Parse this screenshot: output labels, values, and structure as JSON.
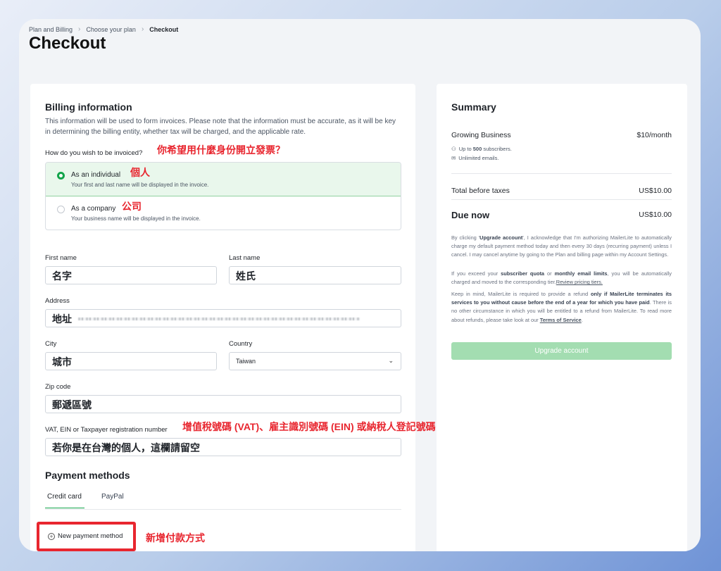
{
  "breadcrumb": {
    "items": [
      "Plan and Billing",
      "Choose your plan",
      "Checkout"
    ]
  },
  "page": {
    "title": "Checkout"
  },
  "billing": {
    "title": "Billing information",
    "description": "This information will be used to form invoices. Please note that the information must be accurate, as it will be key in determining the billing entity, whether tax will be charged, and the applicable rate.",
    "invoice_question": "How do you wish to be invoiced?",
    "invoice_question_annotation": "你希望用什麼身份開立發票？",
    "options": [
      {
        "title": "As an individual",
        "annotation": "個人",
        "subtitle": "Your first and last name will be displayed in the invoice.",
        "selected": true
      },
      {
        "title": "As a company",
        "annotation": "公司",
        "subtitle": "Your business name will be displayed in the invoice.",
        "selected": false
      }
    ]
  },
  "fields": {
    "first_name": {
      "label": "First name",
      "value": "名字"
    },
    "last_name": {
      "label": "Last name",
      "value": "姓氏"
    },
    "address": {
      "label": "Address",
      "value": "地址"
    },
    "city": {
      "label": "City",
      "value": "城市"
    },
    "country": {
      "label": "Country",
      "value": "Taiwan"
    },
    "zip": {
      "label": "Zip code",
      "value": "郵遞區號"
    },
    "vat": {
      "label": "VAT, EIN or Taxpayer registration number",
      "annotation": "增值稅號碼 (VAT)、雇主識別號碼 (EIN) 或納稅人登記號碼",
      "value": "若你是在台灣的個人，這欄請留空"
    }
  },
  "payment": {
    "title": "Payment methods",
    "tabs": [
      "Credit card",
      "PayPal"
    ],
    "new_method": "New payment method",
    "new_method_annotation": "新增付款方式"
  },
  "summary": {
    "title": "Summary",
    "plan_name": "Growing Business",
    "plan_price": "$10/month",
    "subscribers_prefix": "Up to ",
    "subscribers_count": "500",
    "subscribers_suffix": " subscribers.",
    "emails": "Unlimited emails.",
    "total_label": "Total before taxes",
    "total_value": "US$10.00",
    "due_label": "Due now",
    "due_value": "US$10.00",
    "legal1_a": "By clicking '",
    "legal1_b": "Upgrade account",
    "legal1_c": "', I acknowledge that I'm authorizing MailerLite to automatically charge my default payment method today and then every 30 days (recurring payment) unless I cancel. I may cancel anytime by going to the Plan and billing page within my Account Settings.",
    "legal2_a": "If you exceed your ",
    "legal2_b": "subscriber quota",
    "legal2_c": " or ",
    "legal2_d": "monthly email limits",
    "legal2_e": ", you will be automatically charged and moved to the corresponding tier.",
    "legal2_link": "Review pricing tiers.",
    "legal3_a": "Keep in mind, MailerLite is required to provide a refund ",
    "legal3_b": "only if MailerLite terminates its services to you without cause before the end of a year for which you have paid",
    "legal3_c": ". There is no other circumstance in which you will be entitled to a refund from MailerLite. To read more about refunds, please take look at our ",
    "legal3_link": "Terms of Service",
    "legal3_d": ".",
    "button": "Upgrade account"
  },
  "colors": {
    "accent": "#12a44a",
    "annotation": "#e8262f",
    "button_disabled": "#a3ddb1"
  }
}
